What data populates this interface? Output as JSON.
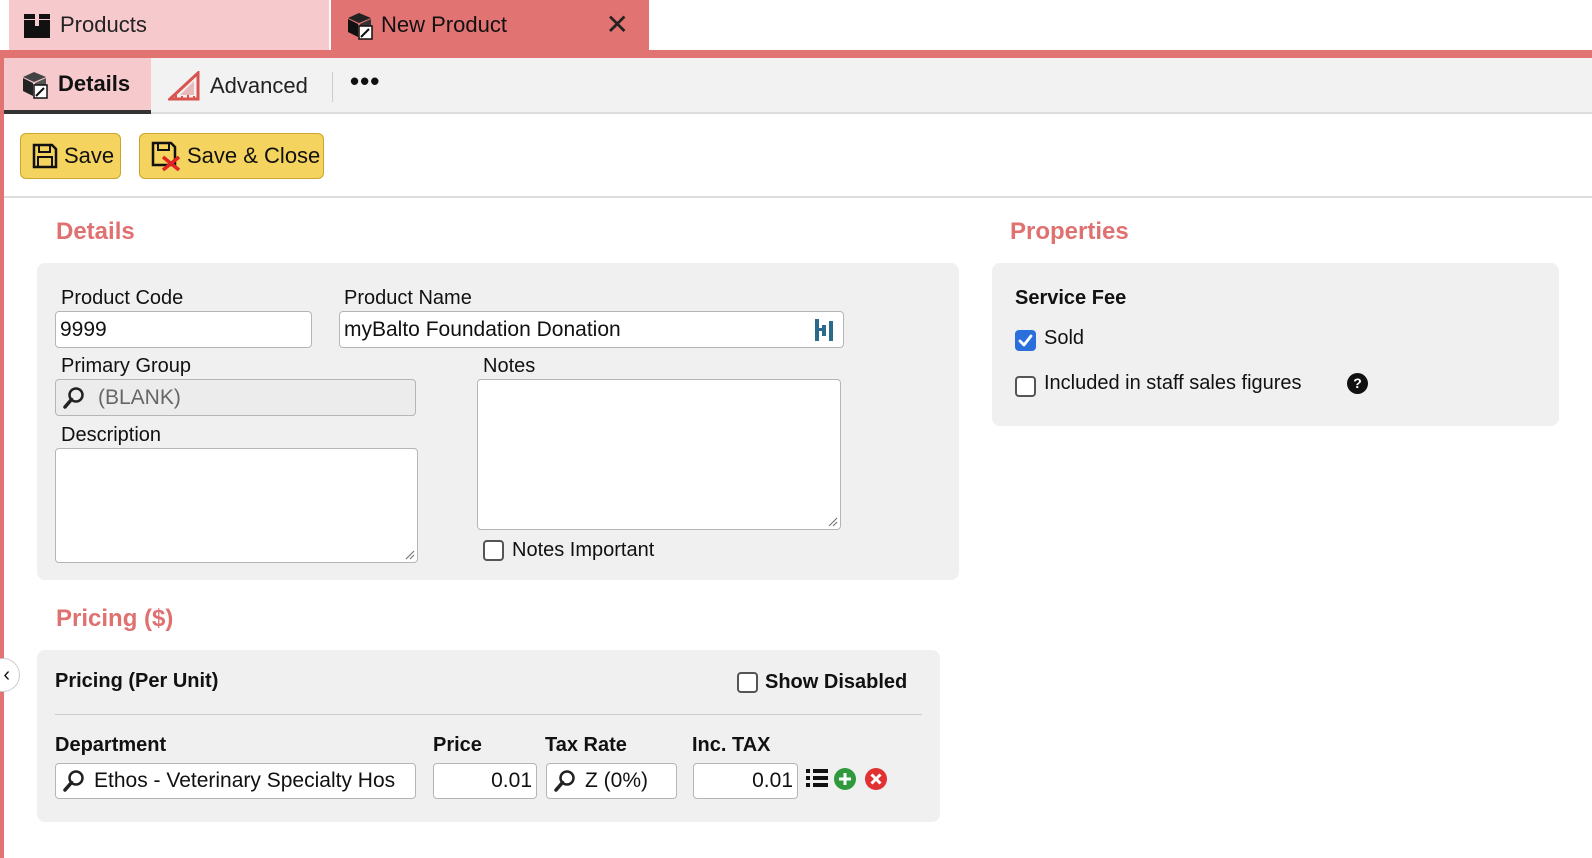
{
  "window_tabs": [
    {
      "label": "Products"
    },
    {
      "label": "New Product",
      "close": "✕"
    }
  ],
  "sub_tabs": {
    "details": "Details",
    "advanced": "Advanced",
    "more": "•••"
  },
  "toolbar": {
    "save_label": "Save",
    "save_close_label": "Save & Close"
  },
  "details": {
    "section_title": "Details",
    "product_code_label": "Product Code",
    "product_code_value": "9999",
    "product_name_label": "Product Name",
    "product_name_value": "myBalto Foundation Donation",
    "primary_group_label": "Primary Group",
    "primary_group_value": "(BLANK)",
    "description_label": "Description",
    "notes_label": "Notes",
    "notes_important_label": "Notes Important"
  },
  "properties": {
    "section_title": "Properties",
    "group_title": "Service Fee",
    "sold_label": "Sold",
    "sold_checked": true,
    "staff_sales_label": "Included in staff sales figures",
    "staff_sales_checked": false,
    "help": "?"
  },
  "pricing": {
    "section_title": "Pricing ($)",
    "panel_title": "Pricing (Per Unit)",
    "show_disabled_label": "Show Disabled",
    "columns": {
      "department": "Department",
      "price": "Price",
      "tax_rate": "Tax Rate",
      "inc_tax": "Inc. TAX"
    },
    "row": {
      "department": "Ethos - Veterinary Specialty Hos",
      "price": "0.01",
      "tax_rate": "Z (0%)",
      "inc_tax": "0.01"
    }
  },
  "colors": {
    "accent": "#e27373",
    "accent_light": "#f6c9cd",
    "section_title": "#e07171",
    "button": "#f4d35e",
    "panel": "#f0f0f0"
  }
}
